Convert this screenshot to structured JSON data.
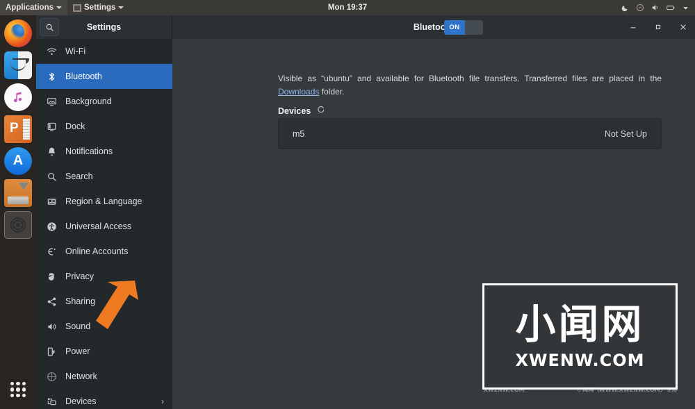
{
  "topbar": {
    "applications_menu": "Applications",
    "settings_menu": "Settings",
    "settings_menu_icon": "app-window-icon",
    "clock": "Mon 19:37",
    "status_icons": [
      "night-light-icon",
      "accessibility-icon",
      "volume-icon",
      "battery-icon",
      "chevron-down-icon"
    ]
  },
  "dock": {
    "items": [
      {
        "name": "firefox",
        "label": "Firefox"
      },
      {
        "name": "finder",
        "label": "Files"
      },
      {
        "name": "music",
        "label": "Music"
      },
      {
        "name": "powerpoint",
        "label": "Presentation"
      },
      {
        "name": "appstore",
        "label": "Software"
      },
      {
        "name": "disk-download",
        "label": "Install Media"
      },
      {
        "name": "settings",
        "label": "Settings",
        "active": true
      }
    ],
    "show_applications": "show-applications-grid"
  },
  "window": {
    "sidebar_title": "Settings",
    "search_icon": "search-icon",
    "main_title": "Bluetooth",
    "toggle": {
      "state": "ON",
      "enabled_color": "#2f74c8"
    },
    "controls": {
      "minimize": "–",
      "maximize": "□",
      "close": "×"
    }
  },
  "sidebar": {
    "items": [
      {
        "label": "Wi-Fi",
        "icon": "wifi-icon",
        "active": false
      },
      {
        "label": "Bluetooth",
        "icon": "bluetooth-icon",
        "active": true
      },
      {
        "label": "Background",
        "icon": "background-icon",
        "active": false
      },
      {
        "label": "Dock",
        "icon": "dock-icon",
        "active": false
      },
      {
        "label": "Notifications",
        "icon": "bell-icon",
        "active": false
      },
      {
        "label": "Search",
        "icon": "search-icon",
        "active": false
      },
      {
        "label": "Region & Language",
        "icon": "region-language-icon",
        "active": false
      },
      {
        "label": "Universal Access",
        "icon": "universal-access-icon",
        "active": false
      },
      {
        "label": "Online Accounts",
        "icon": "online-accounts-icon",
        "active": false
      },
      {
        "label": "Privacy",
        "icon": "privacy-icon",
        "active": false
      },
      {
        "label": "Sharing",
        "icon": "sharing-icon",
        "active": false
      },
      {
        "label": "Sound",
        "icon": "sound-icon",
        "active": false
      },
      {
        "label": "Power",
        "icon": "power-icon",
        "active": false
      },
      {
        "label": "Network",
        "icon": "network-icon",
        "active": false
      },
      {
        "label": "Devices",
        "icon": "devices-icon",
        "active": false,
        "chevron": "›"
      }
    ]
  },
  "content": {
    "description_before": "Visible as “ubuntu” and available for Bluetooth file transfers. Transferred files are placed in the ",
    "description_link": "Downloads",
    "description_after": " folder.",
    "devices_heading": "Devices",
    "spinner_icon": "refresh-spinner-icon",
    "devices": [
      {
        "name": "m5",
        "status": "Not Set Up"
      }
    ]
  },
  "annotation": {
    "arrow_color": "#f07a21",
    "points_at": "Sound"
  },
  "watermark": {
    "cn": "小闻网",
    "en": "XWENW.COM",
    "strip_left": "XWENW.COM",
    "strip_right": "小闻网（WWW.XWENW.COM）专用"
  }
}
